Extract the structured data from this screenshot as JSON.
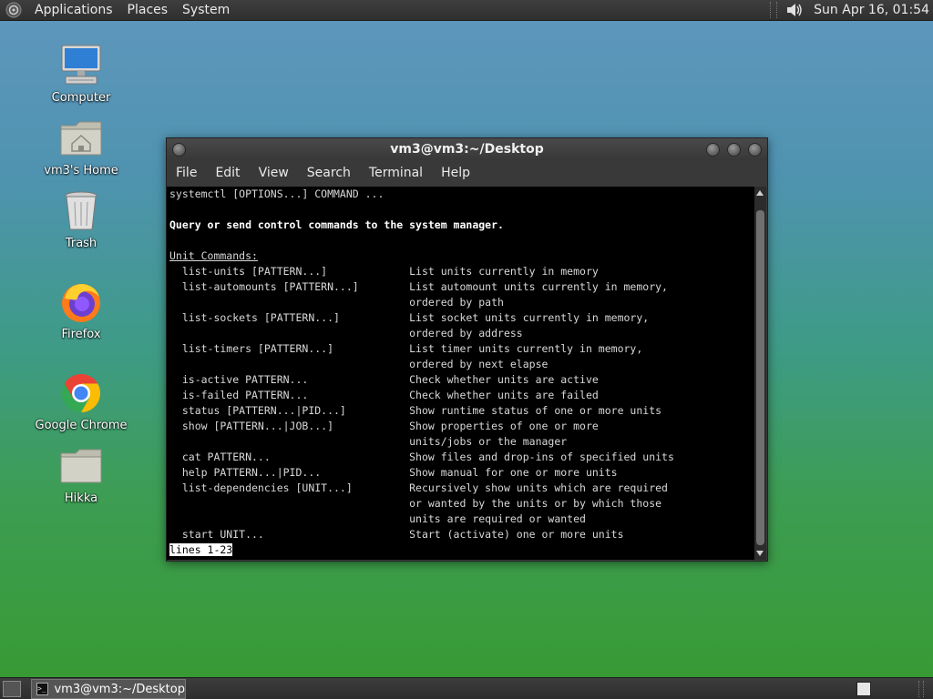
{
  "top_panel": {
    "menus": [
      "Applications",
      "Places",
      "System"
    ],
    "clock": "Sun Apr 16, 01:54",
    "logo_icon": "gnome-foot-icon",
    "volume_icon": "speaker-icon"
  },
  "desktop_icons": [
    {
      "label": "Computer",
      "icon": "computer-icon"
    },
    {
      "label": "vm3's Home",
      "icon": "home-folder-icon"
    },
    {
      "label": "Trash",
      "icon": "trash-icon"
    },
    {
      "label": "Firefox",
      "icon": "firefox-icon"
    },
    {
      "label": "Google Chrome",
      "icon": "chrome-icon"
    },
    {
      "label": "Hikka",
      "icon": "folder-icon"
    }
  ],
  "terminal": {
    "title": "vm3@vm3:~/Desktop",
    "menu": [
      "File",
      "Edit",
      "View",
      "Search",
      "Terminal",
      "Help"
    ],
    "lines": [
      "systemctl [OPTIONS...] COMMAND ...",
      "",
      "Query or send control commands to the system manager.",
      "",
      "Unit Commands:",
      "  list-units [PATTERN...]             List units currently in memory",
      "  list-automounts [PATTERN...]        List automount units currently in memory,",
      "                                      ordered by path",
      "  list-sockets [PATTERN...]           List socket units currently in memory,",
      "                                      ordered by address",
      "  list-timers [PATTERN...]            List timer units currently in memory,",
      "                                      ordered by next elapse",
      "  is-active PATTERN...                Check whether units are active",
      "  is-failed PATTERN...                Check whether units are failed",
      "  status [PATTERN...|PID...]          Show runtime status of one or more units",
      "  show [PATTERN...|JOB...]            Show properties of one or more",
      "                                      units/jobs or the manager",
      "  cat PATTERN...                      Show files and drop-ins of specified units",
      "  help PATTERN...|PID...              Show manual for one or more units",
      "  list-dependencies [UNIT...]         Recursively show units which are required",
      "                                      or wanted by the units or by which those",
      "                                      units are required or wanted",
      "  start UNIT...                       Start (activate) one or more units"
    ],
    "status_line": "lines 1-23"
  },
  "bottom_panel": {
    "task_label": "vm3@vm3:~/Desktop"
  },
  "colors": {
    "panel": "#333333",
    "terminal_bg": "#000000",
    "terminal_fg": "#d8d8d8"
  }
}
